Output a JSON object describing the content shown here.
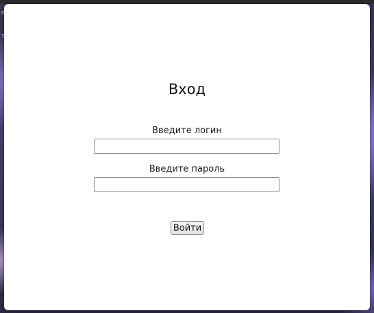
{
  "login": {
    "title": "Вход",
    "username_label": "Введите логин",
    "username_value": "",
    "password_label": "Введите пароль",
    "password_value": "",
    "submit_label": "Войти"
  },
  "background": {
    "edge_text_1": "п",
    "edge_text_2": "т"
  }
}
